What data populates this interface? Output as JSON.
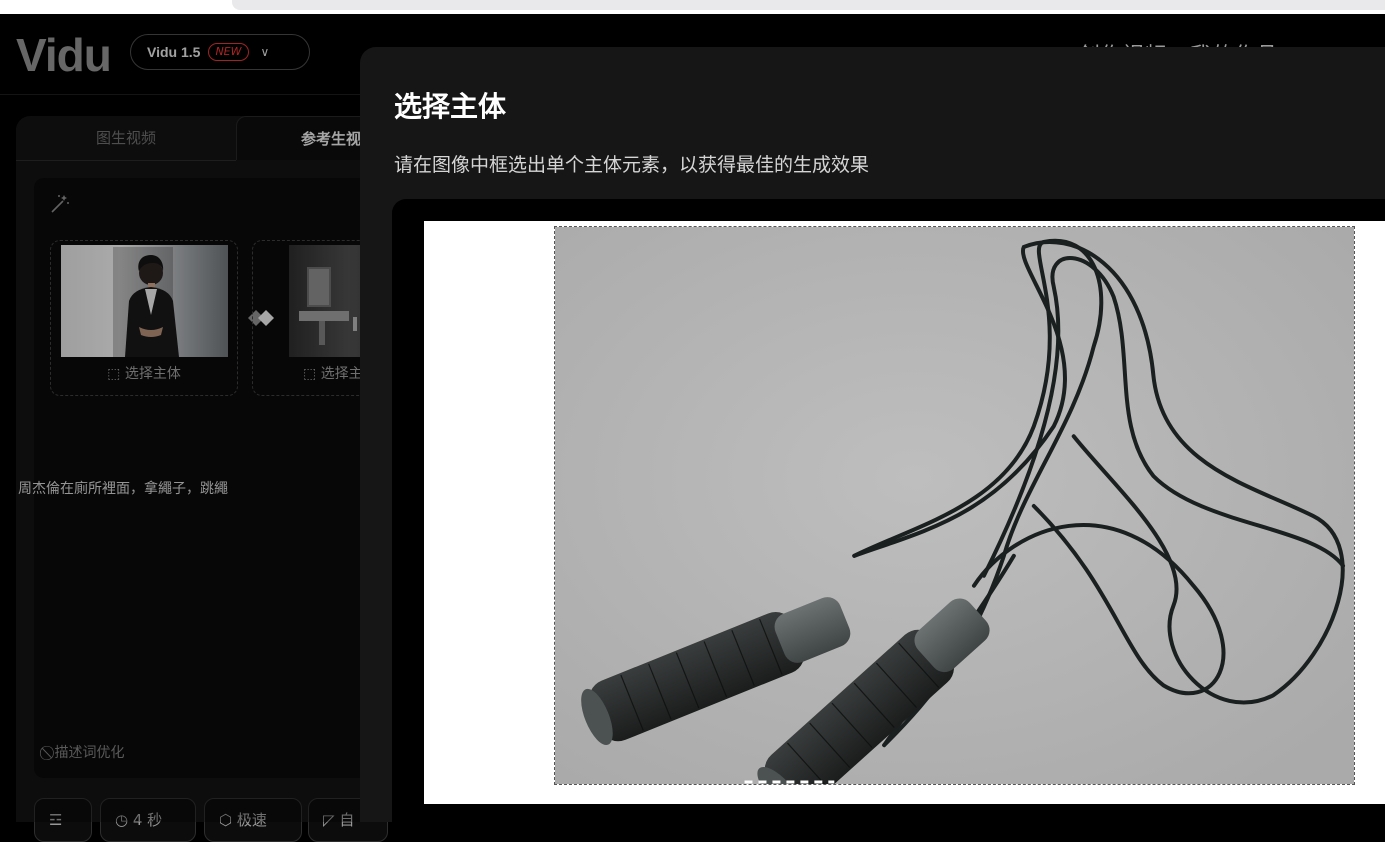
{
  "header": {
    "logo": "Vidu",
    "model_name": "Vidu 1.5",
    "model_badge": "NEW",
    "nav": [
      "创作视频",
      "我的作品"
    ]
  },
  "panel": {
    "tabs": [
      "图生视频",
      "参考生视频"
    ],
    "cards": [
      {
        "label": "选择主体"
      },
      {
        "label": "选择主体"
      }
    ],
    "prompt_text": "周杰倫在廁所裡面，拿繩子，跳繩",
    "optimize_label": "描述词优化",
    "bottom_buttons": [
      {
        "icon": "settings-icon",
        "label": ""
      },
      {
        "icon": "clock-icon",
        "label": "4 秒"
      },
      {
        "icon": "cube-icon",
        "label": "极速"
      },
      {
        "icon": "ratio-icon",
        "label": "自"
      }
    ]
  },
  "modal": {
    "title": "选择主体",
    "subtitle": "请在图像中框选出单个主体元素，以获得最佳的生成效果"
  },
  "colors": {
    "background": "#000000",
    "panel": "#121212",
    "modal": "#161616",
    "badge": "#e33333"
  }
}
